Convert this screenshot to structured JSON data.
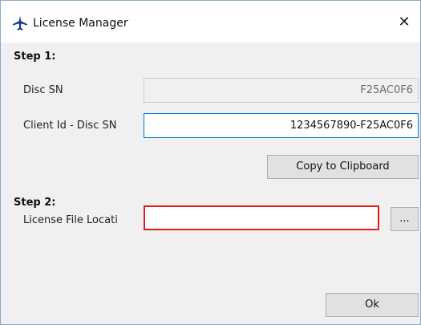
{
  "window": {
    "title": "License Manager",
    "close_glyph": "✕"
  },
  "step1": {
    "label": "Step 1:",
    "disc_sn_label": "Disc SN",
    "disc_sn_value": "F25AC0F6",
    "client_id_label": "Client Id - Disc SN",
    "client_id_value": "1234567890-F25AC0F6",
    "copy_button": "Copy to Clipboard"
  },
  "step2": {
    "label": "Step 2:",
    "license_file_label": "License File Locati",
    "license_file_value": "",
    "browse_button": "..."
  },
  "footer": {
    "ok_button": "Ok"
  },
  "colors": {
    "focus_border": "#0078d7",
    "error_border": "#e02020",
    "icon_color": "#1a3a8f"
  },
  "icons": {
    "app_icon": "airplane-icon"
  }
}
